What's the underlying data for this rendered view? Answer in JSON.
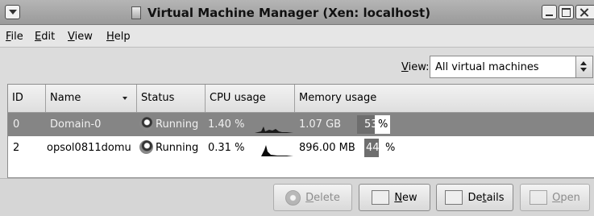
{
  "window": {
    "title": "Virtual Machine Manager (Xen: localhost)"
  },
  "menu": [
    {
      "label": "File",
      "mnemonic": "F",
      "rest": "ile"
    },
    {
      "label": "Edit",
      "mnemonic": "E",
      "rest": "dit"
    },
    {
      "label": "View",
      "mnemonic": "V",
      "rest": "iew"
    },
    {
      "label": "Help",
      "mnemonic": "H",
      "rest": "elp"
    }
  ],
  "view_filter": {
    "label_mnemonic": "V",
    "label_rest": "iew:",
    "selected": "All virtual machines"
  },
  "table": {
    "columns": [
      "ID",
      "Name",
      "Status",
      "CPU usage",
      "Memory usage"
    ],
    "rows": [
      {
        "id": "0",
        "name": "Domain-0",
        "status": "Running",
        "cpu": "1.40 %",
        "memory": "1.07 GB",
        "memory_pct": "53",
        "memory_fraction": 0.53,
        "selected": true
      },
      {
        "id": "2",
        "name": "opsol0811domu",
        "status": "Running",
        "cpu": "0.31 %",
        "memory": "896.00 MB",
        "memory_pct": "44",
        "memory_fraction": 0.44,
        "selected": false
      }
    ],
    "pct_suffix": "%"
  },
  "buttons": {
    "delete": {
      "mnemonic": "D",
      "rest": "elete",
      "enabled": false
    },
    "new": {
      "mnemonic": "N",
      "rest": "ew",
      "enabled": true
    },
    "details": {
      "pre": "De",
      "mnemonic": "t",
      "rest": "ails",
      "enabled": true
    },
    "open": {
      "mnemonic": "O",
      "rest": "pen",
      "enabled": false
    }
  },
  "icons": [
    "window-menu-icon",
    "app-icon",
    "minimize-icon",
    "maximize-icon",
    "close-icon",
    "running-status-icon",
    "delete-icon",
    "new-icon",
    "details-icon",
    "open-icon"
  ]
}
